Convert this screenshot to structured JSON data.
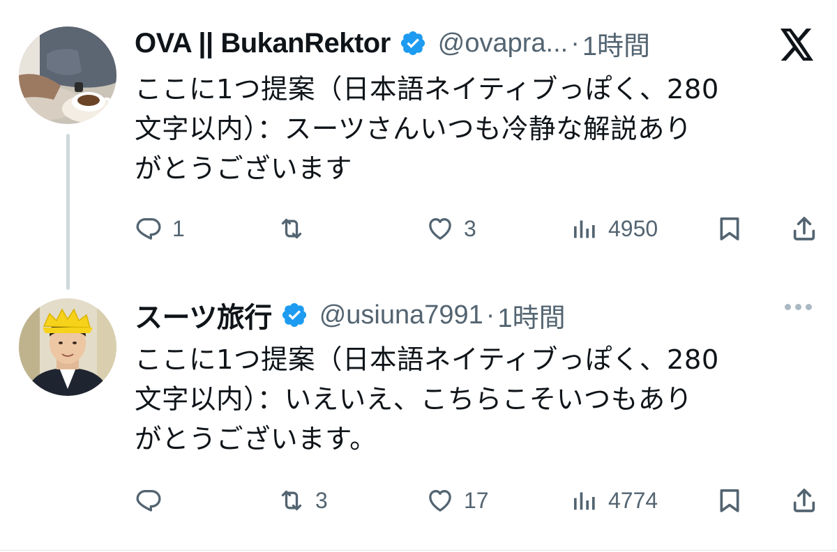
{
  "tweets": [
    {
      "display_name": "OVA || BukanRektor",
      "handle": "@ovapra...",
      "separator": "·",
      "time": "1時間",
      "text": "ここに1つ提案（日本語ネイティブっぽく、280\n文字以内）：スーツさんいつも冷静な解説あり\nがとうございます",
      "actions": {
        "reply": "1",
        "retweet": "",
        "like": "3",
        "views": "4950"
      }
    },
    {
      "display_name": "スーツ旅行",
      "handle": "@usiuna7991",
      "separator": "·",
      "time": "1時間",
      "text": "ここに1つ提案（日本語ネイティブっぽく、280\n文字以内）：いえいえ、こちらこそいつもあり\nがとうございます。",
      "actions": {
        "reply": "",
        "retweet": "3",
        "like": "17",
        "views": "4774"
      }
    }
  ],
  "colors": {
    "text": "#0f1419",
    "muted": "#536471",
    "verified": "#1d9bf0",
    "thread_line": "#cfd9de"
  },
  "icons": [
    "x-logo-icon",
    "verified-badge-icon",
    "reply-icon",
    "retweet-icon",
    "like-icon",
    "views-icon",
    "bookmark-icon",
    "share-icon",
    "more-icon"
  ]
}
